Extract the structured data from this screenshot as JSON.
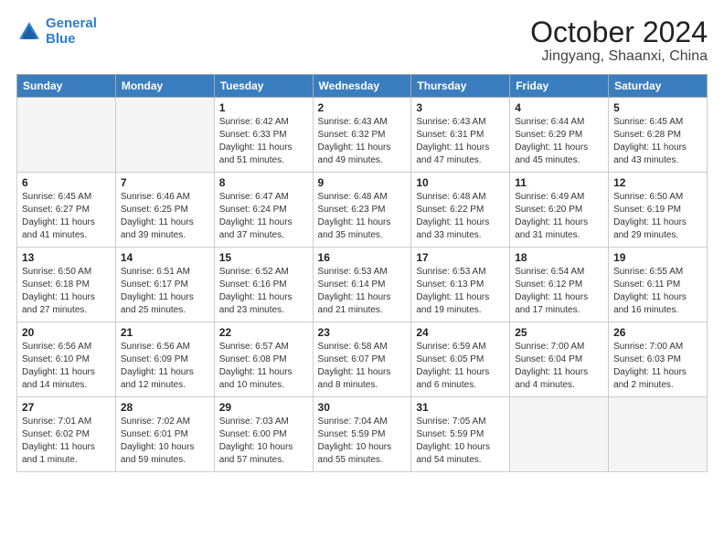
{
  "header": {
    "logo_line1": "General",
    "logo_line2": "Blue",
    "title": "October 2024",
    "subtitle": "Jingyang, Shaanxi, China"
  },
  "weekdays": [
    "Sunday",
    "Monday",
    "Tuesday",
    "Wednesday",
    "Thursday",
    "Friday",
    "Saturday"
  ],
  "weeks": [
    [
      {
        "day": "",
        "info": ""
      },
      {
        "day": "",
        "info": ""
      },
      {
        "day": "1",
        "info": "Sunrise: 6:42 AM\nSunset: 6:33 PM\nDaylight: 11 hours and 51 minutes."
      },
      {
        "day": "2",
        "info": "Sunrise: 6:43 AM\nSunset: 6:32 PM\nDaylight: 11 hours and 49 minutes."
      },
      {
        "day": "3",
        "info": "Sunrise: 6:43 AM\nSunset: 6:31 PM\nDaylight: 11 hours and 47 minutes."
      },
      {
        "day": "4",
        "info": "Sunrise: 6:44 AM\nSunset: 6:29 PM\nDaylight: 11 hours and 45 minutes."
      },
      {
        "day": "5",
        "info": "Sunrise: 6:45 AM\nSunset: 6:28 PM\nDaylight: 11 hours and 43 minutes."
      }
    ],
    [
      {
        "day": "6",
        "info": "Sunrise: 6:45 AM\nSunset: 6:27 PM\nDaylight: 11 hours and 41 minutes."
      },
      {
        "day": "7",
        "info": "Sunrise: 6:46 AM\nSunset: 6:25 PM\nDaylight: 11 hours and 39 minutes."
      },
      {
        "day": "8",
        "info": "Sunrise: 6:47 AM\nSunset: 6:24 PM\nDaylight: 11 hours and 37 minutes."
      },
      {
        "day": "9",
        "info": "Sunrise: 6:48 AM\nSunset: 6:23 PM\nDaylight: 11 hours and 35 minutes."
      },
      {
        "day": "10",
        "info": "Sunrise: 6:48 AM\nSunset: 6:22 PM\nDaylight: 11 hours and 33 minutes."
      },
      {
        "day": "11",
        "info": "Sunrise: 6:49 AM\nSunset: 6:20 PM\nDaylight: 11 hours and 31 minutes."
      },
      {
        "day": "12",
        "info": "Sunrise: 6:50 AM\nSunset: 6:19 PM\nDaylight: 11 hours and 29 minutes."
      }
    ],
    [
      {
        "day": "13",
        "info": "Sunrise: 6:50 AM\nSunset: 6:18 PM\nDaylight: 11 hours and 27 minutes."
      },
      {
        "day": "14",
        "info": "Sunrise: 6:51 AM\nSunset: 6:17 PM\nDaylight: 11 hours and 25 minutes."
      },
      {
        "day": "15",
        "info": "Sunrise: 6:52 AM\nSunset: 6:16 PM\nDaylight: 11 hours and 23 minutes."
      },
      {
        "day": "16",
        "info": "Sunrise: 6:53 AM\nSunset: 6:14 PM\nDaylight: 11 hours and 21 minutes."
      },
      {
        "day": "17",
        "info": "Sunrise: 6:53 AM\nSunset: 6:13 PM\nDaylight: 11 hours and 19 minutes."
      },
      {
        "day": "18",
        "info": "Sunrise: 6:54 AM\nSunset: 6:12 PM\nDaylight: 11 hours and 17 minutes."
      },
      {
        "day": "19",
        "info": "Sunrise: 6:55 AM\nSunset: 6:11 PM\nDaylight: 11 hours and 16 minutes."
      }
    ],
    [
      {
        "day": "20",
        "info": "Sunrise: 6:56 AM\nSunset: 6:10 PM\nDaylight: 11 hours and 14 minutes."
      },
      {
        "day": "21",
        "info": "Sunrise: 6:56 AM\nSunset: 6:09 PM\nDaylight: 11 hours and 12 minutes."
      },
      {
        "day": "22",
        "info": "Sunrise: 6:57 AM\nSunset: 6:08 PM\nDaylight: 11 hours and 10 minutes."
      },
      {
        "day": "23",
        "info": "Sunrise: 6:58 AM\nSunset: 6:07 PM\nDaylight: 11 hours and 8 minutes."
      },
      {
        "day": "24",
        "info": "Sunrise: 6:59 AM\nSunset: 6:05 PM\nDaylight: 11 hours and 6 minutes."
      },
      {
        "day": "25",
        "info": "Sunrise: 7:00 AM\nSunset: 6:04 PM\nDaylight: 11 hours and 4 minutes."
      },
      {
        "day": "26",
        "info": "Sunrise: 7:00 AM\nSunset: 6:03 PM\nDaylight: 11 hours and 2 minutes."
      }
    ],
    [
      {
        "day": "27",
        "info": "Sunrise: 7:01 AM\nSunset: 6:02 PM\nDaylight: 11 hours and 1 minute."
      },
      {
        "day": "28",
        "info": "Sunrise: 7:02 AM\nSunset: 6:01 PM\nDaylight: 10 hours and 59 minutes."
      },
      {
        "day": "29",
        "info": "Sunrise: 7:03 AM\nSunset: 6:00 PM\nDaylight: 10 hours and 57 minutes."
      },
      {
        "day": "30",
        "info": "Sunrise: 7:04 AM\nSunset: 5:59 PM\nDaylight: 10 hours and 55 minutes."
      },
      {
        "day": "31",
        "info": "Sunrise: 7:05 AM\nSunset: 5:59 PM\nDaylight: 10 hours and 54 minutes."
      },
      {
        "day": "",
        "info": ""
      },
      {
        "day": "",
        "info": ""
      }
    ]
  ]
}
